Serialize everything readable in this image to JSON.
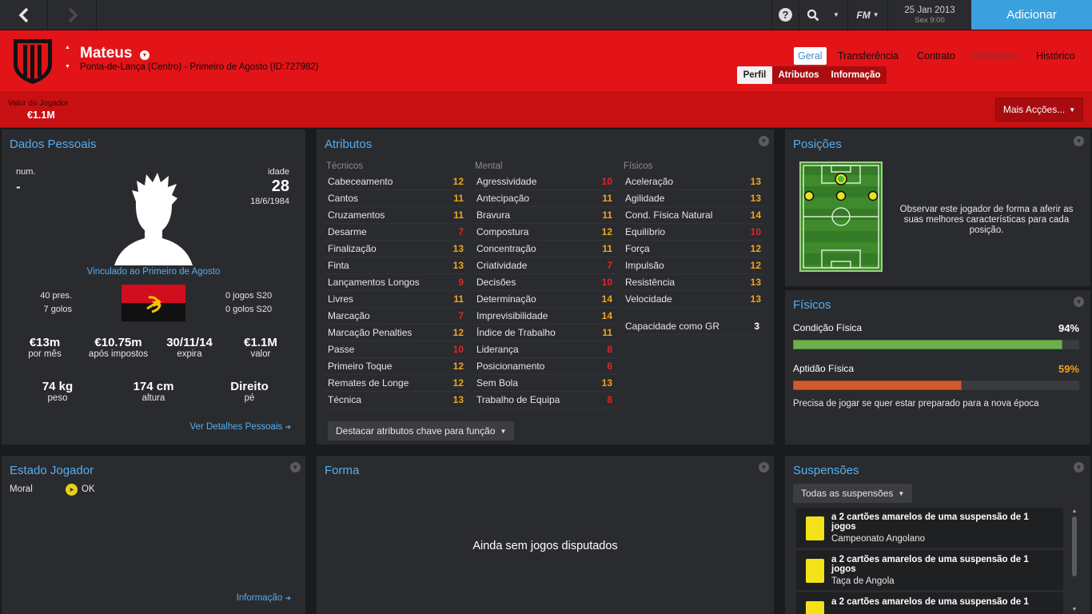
{
  "topbar": {
    "back_icon": "chevron-left-icon",
    "forward_icon": "chevron-right-icon",
    "help_icon": "help-icon",
    "search_icon": "search-icon",
    "fm_label": "FM",
    "date": "25 Jan 2013",
    "day_time": "Sex 9:00",
    "add_button": "Adicionar"
  },
  "player": {
    "name": "Mateus",
    "subtitle": "Ponta-de-Lança (Centro) - Primeiro de Agosto (ID:727982)",
    "value_label": "Valor do Jogador",
    "value": "€1.1M",
    "more_actions": "Mais Acções..."
  },
  "tabs": {
    "main": [
      "Geral",
      "Transferência",
      "Contrato",
      "Relatórios",
      "Histórico"
    ],
    "sub": [
      "Perfil",
      "Atributos",
      "Informação"
    ]
  },
  "personal": {
    "title": "Dados Pessoais",
    "num_label": "num.",
    "num_value": "-",
    "age_label": "idade",
    "age_value": "28",
    "dob": "18/6/1984",
    "club_link": "Vinculado ao Primeiro de Agosto",
    "caps": "40 pres.",
    "goals": "7 golos",
    "u20_games": "0 jogos S20",
    "u20_goals": "0 golos S20",
    "stats": [
      {
        "value": "€13m",
        "label": "por mês"
      },
      {
        "value": "€10.75m",
        "label": "após impostos"
      },
      {
        "value": "30/11/14",
        "label": "expira"
      },
      {
        "value": "€1.1M",
        "label": "valor"
      }
    ],
    "body": [
      {
        "value": "74 kg",
        "label": "peso"
      },
      {
        "value": "174 cm",
        "label": "altura"
      },
      {
        "value": "Direito",
        "label": "pé"
      }
    ],
    "details_link": "Ver Detalhes Pessoais"
  },
  "attributes": {
    "title": "Atributos",
    "technical_header": "Técnicos",
    "mental_header": "Mental",
    "physical_header": "Físicos",
    "technical": [
      {
        "name": "Cabeceamento",
        "value": "12"
      },
      {
        "name": "Cantos",
        "value": "11"
      },
      {
        "name": "Cruzamentos",
        "value": "11"
      },
      {
        "name": "Desarme",
        "value": "7"
      },
      {
        "name": "Finalização",
        "value": "13"
      },
      {
        "name": "Finta",
        "value": "13"
      },
      {
        "name": "Lançamentos Longos",
        "value": "9"
      },
      {
        "name": "Livres",
        "value": "11"
      },
      {
        "name": "Marcação",
        "value": "7"
      },
      {
        "name": "Marcação Penalties",
        "value": "12"
      },
      {
        "name": "Passe",
        "value": "10"
      },
      {
        "name": "Primeiro Toque",
        "value": "12"
      },
      {
        "name": "Remates de Longe",
        "value": "12"
      },
      {
        "name": "Técnica",
        "value": "13"
      }
    ],
    "mental": [
      {
        "name": "Agressividade",
        "value": "10"
      },
      {
        "name": "Antecipação",
        "value": "11"
      },
      {
        "name": "Bravura",
        "value": "11"
      },
      {
        "name": "Compostura",
        "value": "12"
      },
      {
        "name": "Concentração",
        "value": "11"
      },
      {
        "name": "Criatividade",
        "value": "7"
      },
      {
        "name": "Decisões",
        "value": "10"
      },
      {
        "name": "Determinação",
        "value": "14"
      },
      {
        "name": "Imprevisibilidade",
        "value": "14"
      },
      {
        "name": "Índice de Trabalho",
        "value": "11"
      },
      {
        "name": "Liderança",
        "value": "8"
      },
      {
        "name": "Posicionamento",
        "value": "6"
      },
      {
        "name": "Sem Bola",
        "value": "13"
      },
      {
        "name": "Trabalho de Equipa",
        "value": "8"
      }
    ],
    "physical": [
      {
        "name": "Aceleração",
        "value": "13"
      },
      {
        "name": "Agilidade",
        "value": "13"
      },
      {
        "name": "Cond. Física Natural",
        "value": "14"
      },
      {
        "name": "Equilíbrio",
        "value": "10"
      },
      {
        "name": "Força",
        "value": "12"
      },
      {
        "name": "Impulsão",
        "value": "12"
      },
      {
        "name": "Resistência",
        "value": "13"
      },
      {
        "name": "Velocidade",
        "value": "13"
      }
    ],
    "gk_label": "Capacidade como GR",
    "gk_value": "3",
    "highlight_button": "Destacar atributos chave para função"
  },
  "positions": {
    "title": "Posições",
    "text": "Observar este jogador de forma a aferir as suas melhores características para cada posição."
  },
  "physicals": {
    "title": "Físicos",
    "condition_label": "Condição Física",
    "condition_value": "94%",
    "condition_pct": 94,
    "fitness_label": "Aptidão Física",
    "fitness_value": "59%",
    "fitness_pct": 59,
    "note": "Precisa de jogar se quer estar preparado para a nova época"
  },
  "status": {
    "title": "Estado Jogador",
    "morale_label": "Moral",
    "morale_value": "OK",
    "info_link": "Informação"
  },
  "form": {
    "title": "Forma",
    "empty": "Ainda sem jogos disputados"
  },
  "suspensions": {
    "title": "Suspensões",
    "filter": "Todas as suspensões",
    "items": [
      {
        "text": "a 2 cartões amarelos de uma suspensão de 1 jogos",
        "competition": "Campeonato Angolano"
      },
      {
        "text": "a 2 cartões amarelos de uma suspensão de 1 jogos",
        "competition": "Taça de Angola"
      },
      {
        "text": "a 2 cartões amarelos de uma suspensão de 1",
        "competition": ""
      }
    ]
  },
  "colors": {
    "accent": "#3aa0de",
    "header_red": "#e21418",
    "attr_orange": "#f0a41c",
    "attr_red": "#e02626",
    "condition_green": "#6bb04a",
    "fitness_orange": "#d05b2a"
  }
}
